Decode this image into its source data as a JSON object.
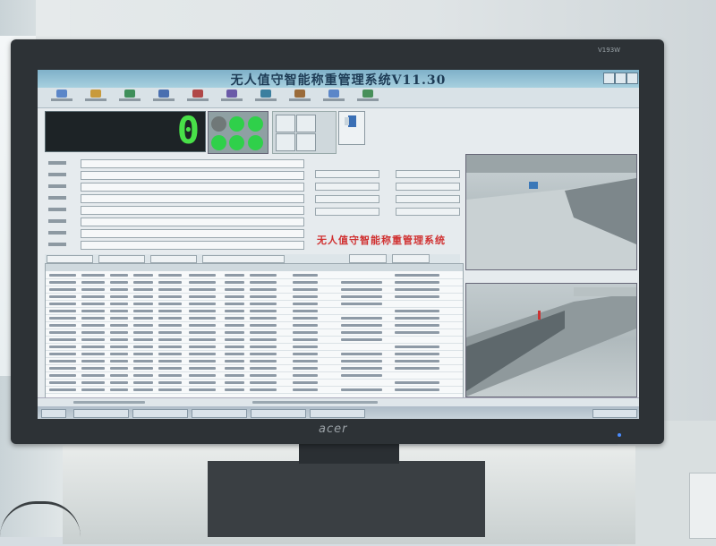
{
  "app": {
    "title": "无人值守智能称重管理系统V11.30"
  },
  "weight_display": {
    "value": "0"
  },
  "banner": {
    "text": "无人值守智能称重管理系统"
  },
  "monitor": {
    "brand": "acer",
    "model": "V193W"
  },
  "colors": {
    "weight_green": "#48e048",
    "banner_red": "#d03030",
    "title_bar": "#7fb1c9"
  }
}
